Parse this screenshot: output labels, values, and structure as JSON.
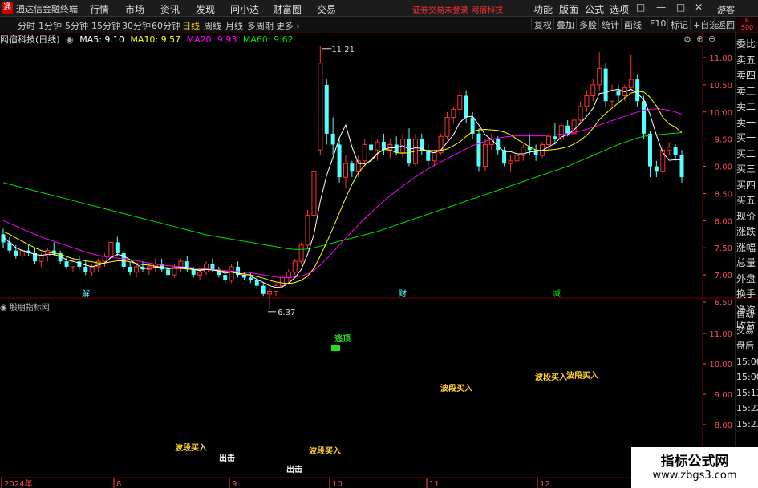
{
  "menubar": {
    "app_title": "通达信金融终端",
    "logo_glyph": "通",
    "items": [
      "行情",
      "市场",
      "资讯",
      "发现",
      "问小达",
      "财富圈",
      "交易"
    ],
    "notice": "证券交易未登录 网宿科技",
    "right_items": [
      "功能",
      "版面",
      "公式",
      "选项"
    ],
    "guest": "游客",
    "window_buttons": [
      "□",
      "—",
      "□",
      "✕"
    ]
  },
  "toolbar": {
    "timeframes": [
      "分时",
      "1分钟",
      "5分钟",
      "15分钟",
      "30分钟",
      "60分钟",
      "日线",
      "周线",
      "月线",
      "多周期",
      "更多 ›"
    ],
    "active": "日线",
    "right_buttons": [
      "复权",
      "叠加",
      "多股",
      "统计",
      "画线",
      "F10",
      "标记",
      "+自选",
      "返回"
    ],
    "corner_top": "R",
    "corner_bottom": "500"
  },
  "info": {
    "stock": "网宿科技(日线)",
    "ma5": "MA5: 9.10",
    "ma10": "MA10: 9.57",
    "ma20": "MA20: 9.93",
    "ma60": "MA60: 9.62"
  },
  "colors": {
    "up": "#ff3232",
    "down": "#54ffff",
    "ma5": "#ffffff",
    "ma10": "#ffff00",
    "ma20": "#ff00ff",
    "ma60": "#00e000",
    "grid": "#7a0000",
    "axis_text": "#ff5050",
    "signal": "#ffd030"
  },
  "price_axis": [
    "11.00",
    "10.50",
    "10.00",
    "9.50",
    "9.00",
    "8.50",
    "8.00",
    "7.50",
    "7.00",
    "6.50"
  ],
  "chart_data": {
    "type": "candlestick",
    "ylim": [
      6.3,
      11.3
    ],
    "annotations": {
      "high": "11.21",
      "low": "6.37"
    },
    "event_labels": [
      "解",
      "财",
      "减"
    ],
    "ohlc": [
      [
        7.75,
        7.85,
        7.5,
        7.6
      ],
      [
        7.6,
        7.7,
        7.4,
        7.45
      ],
      [
        7.45,
        7.55,
        7.3,
        7.35
      ],
      [
        7.35,
        7.5,
        7.25,
        7.45
      ],
      [
        7.45,
        7.55,
        7.35,
        7.4
      ],
      [
        7.4,
        7.5,
        7.2,
        7.25
      ],
      [
        7.25,
        7.4,
        7.15,
        7.35
      ],
      [
        7.35,
        7.5,
        7.25,
        7.45
      ],
      [
        7.45,
        7.6,
        7.35,
        7.4
      ],
      [
        7.4,
        7.45,
        7.2,
        7.25
      ],
      [
        7.25,
        7.35,
        7.1,
        7.15
      ],
      [
        7.15,
        7.3,
        7.05,
        7.25
      ],
      [
        7.25,
        7.35,
        7.1,
        7.15
      ],
      [
        7.15,
        7.25,
        7.0,
        7.05
      ],
      [
        7.05,
        7.2,
        6.98,
        7.15
      ],
      [
        7.15,
        7.3,
        7.05,
        7.25
      ],
      [
        7.25,
        7.4,
        7.15,
        7.35
      ],
      [
        7.35,
        7.7,
        7.3,
        7.6
      ],
      [
        7.6,
        7.7,
        7.35,
        7.4
      ],
      [
        7.4,
        7.45,
        7.1,
        7.15
      ],
      [
        7.15,
        7.25,
        7.0,
        7.05
      ],
      [
        7.05,
        7.2,
        6.95,
        7.15
      ],
      [
        7.15,
        7.25,
        7.05,
        7.1
      ],
      [
        7.1,
        7.2,
        7.0,
        7.15
      ],
      [
        7.15,
        7.3,
        7.05,
        7.2
      ],
      [
        7.2,
        7.3,
        7.05,
        7.1
      ],
      [
        7.1,
        7.15,
        6.95,
        7.0
      ],
      [
        7.0,
        7.2,
        6.95,
        7.15
      ],
      [
        7.15,
        7.3,
        7.05,
        7.25
      ],
      [
        7.25,
        7.35,
        7.05,
        7.1
      ],
      [
        7.1,
        7.15,
        6.95,
        7.0
      ],
      [
        7.0,
        7.1,
        6.9,
        7.05
      ],
      [
        7.05,
        7.25,
        7.0,
        7.2
      ],
      [
        7.2,
        7.3,
        7.05,
        7.1
      ],
      [
        7.1,
        7.15,
        6.95,
        7.0
      ],
      [
        7.0,
        7.05,
        6.85,
        6.9
      ],
      [
        6.9,
        7.2,
        6.85,
        7.15
      ],
      [
        7.15,
        7.25,
        6.95,
        7.0
      ],
      [
        7.0,
        7.05,
        6.9,
        6.95
      ],
      [
        6.95,
        7.05,
        6.85,
        6.9
      ],
      [
        6.9,
        6.95,
        6.75,
        6.8
      ],
      [
        6.8,
        6.85,
        6.6,
        6.65
      ],
      [
        6.65,
        6.75,
        6.37,
        6.7
      ],
      [
        6.7,
        6.85,
        6.6,
        6.8
      ],
      [
        6.8,
        7.0,
        6.75,
        6.95
      ],
      [
        6.95,
        7.1,
        6.85,
        7.05
      ],
      [
        7.05,
        7.3,
        7.0,
        7.25
      ],
      [
        7.25,
        7.6,
        7.2,
        7.55
      ],
      [
        7.55,
        8.2,
        7.5,
        8.1
      ],
      [
        8.1,
        9.0,
        8.0,
        8.9
      ],
      [
        9.3,
        11.21,
        9.2,
        10.9
      ],
      [
        10.5,
        10.6,
        9.4,
        9.6
      ],
      [
        9.6,
        9.9,
        9.2,
        9.4
      ],
      [
        9.4,
        9.5,
        8.7,
        8.8
      ],
      [
        8.8,
        9.2,
        8.6,
        9.05
      ],
      [
        9.05,
        9.1,
        8.8,
        8.9
      ],
      [
        8.9,
        9.2,
        8.8,
        9.1
      ],
      [
        9.1,
        9.5,
        9.0,
        9.4
      ],
      [
        9.4,
        9.6,
        9.2,
        9.3
      ],
      [
        9.3,
        9.5,
        9.1,
        9.45
      ],
      [
        9.45,
        9.6,
        9.2,
        9.3
      ],
      [
        9.3,
        9.5,
        9.15,
        9.4
      ],
      [
        9.4,
        9.55,
        9.2,
        9.25
      ],
      [
        9.25,
        9.6,
        9.15,
        9.5
      ],
      [
        9.5,
        9.7,
        9.0,
        9.05
      ],
      [
        9.05,
        9.6,
        9.0,
        9.5
      ],
      [
        9.5,
        9.6,
        9.2,
        9.3
      ],
      [
        9.3,
        9.4,
        9.0,
        9.1
      ],
      [
        9.1,
        9.3,
        9.0,
        9.25
      ],
      [
        9.25,
        9.6,
        9.2,
        9.55
      ],
      [
        9.55,
        10.0,
        9.5,
        9.9
      ],
      [
        9.9,
        10.1,
        9.8,
        10.05
      ],
      [
        10.05,
        10.5,
        9.95,
        10.3
      ],
      [
        10.3,
        10.4,
        9.8,
        9.9
      ],
      [
        9.9,
        10.0,
        9.5,
        9.6
      ],
      [
        9.6,
        9.7,
        8.9,
        9.0
      ],
      [
        9.0,
        9.5,
        8.9,
        9.4
      ],
      [
        9.4,
        9.6,
        9.3,
        9.5
      ],
      [
        9.5,
        9.55,
        9.2,
        9.3
      ],
      [
        9.3,
        9.35,
        9.0,
        9.05
      ],
      [
        9.05,
        9.2,
        8.9,
        9.1
      ],
      [
        9.1,
        9.3,
        9.0,
        9.2
      ],
      [
        9.2,
        9.4,
        9.1,
        9.35
      ],
      [
        9.35,
        9.6,
        9.2,
        9.3
      ],
      [
        9.3,
        9.4,
        9.1,
        9.2
      ],
      [
        9.2,
        9.45,
        9.15,
        9.4
      ],
      [
        9.4,
        9.6,
        9.3,
        9.55
      ],
      [
        9.55,
        9.8,
        9.4,
        9.5
      ],
      [
        9.5,
        9.8,
        9.45,
        9.75
      ],
      [
        9.75,
        9.85,
        9.55,
        9.6
      ],
      [
        9.6,
        9.9,
        9.55,
        9.85
      ],
      [
        9.85,
        10.2,
        9.8,
        10.1
      ],
      [
        10.1,
        10.4,
        10.0,
        10.3
      ],
      [
        10.3,
        10.6,
        10.2,
        10.5
      ],
      [
        10.5,
        11.1,
        10.4,
        10.8
      ],
      [
        10.8,
        10.9,
        10.1,
        10.2
      ],
      [
        10.2,
        10.5,
        10.1,
        10.4
      ],
      [
        10.4,
        10.5,
        10.2,
        10.3
      ],
      [
        10.3,
        10.5,
        10.2,
        10.45
      ],
      [
        10.45,
        11.05,
        10.4,
        10.6
      ],
      [
        10.6,
        10.7,
        10.1,
        10.2
      ],
      [
        10.2,
        10.3,
        9.5,
        9.6
      ],
      [
        9.6,
        9.65,
        8.8,
        9.0
      ],
      [
        9.0,
        9.1,
        8.8,
        8.9
      ],
      [
        8.9,
        9.4,
        8.85,
        9.3
      ],
      [
        9.3,
        9.45,
        9.2,
        9.35
      ],
      [
        9.35,
        9.4,
        9.1,
        9.2
      ],
      [
        9.2,
        9.3,
        8.7,
        8.8
      ]
    ],
    "ma5": [
      7.7,
      7.6,
      7.5,
      7.45,
      7.42,
      7.38,
      7.36,
      7.38,
      7.38,
      7.34,
      7.28,
      7.25,
      7.22,
      7.18,
      7.15,
      7.18,
      7.22,
      7.32,
      7.38,
      7.35,
      7.28,
      7.2,
      7.12,
      7.12,
      7.14,
      7.14,
      7.11,
      7.13,
      7.14,
      7.14,
      7.1,
      7.08,
      7.1,
      7.09,
      7.07,
      7.03,
      7.06,
      7.03,
      6.99,
      6.98,
      6.92,
      6.86,
      6.8,
      6.77,
      6.78,
      6.85,
      6.95,
      7.1,
      7.38,
      7.75,
      8.36,
      8.83,
      9.16,
      9.52,
      9.76,
      9.35,
      9.05,
      9.05,
      9.1,
      9.23,
      9.31,
      9.34,
      9.34,
      9.38,
      9.31,
      9.34,
      9.33,
      9.27,
      9.25,
      9.3,
      9.44,
      9.58,
      9.81,
      9.91,
      9.92,
      9.76,
      9.58,
      9.49,
      9.37,
      9.27,
      9.27,
      9.23,
      9.23,
      9.26,
      9.28,
      9.29,
      9.36,
      9.42,
      9.54,
      9.58,
      9.67,
      9.79,
      9.92,
      10.07,
      10.34,
      10.36,
      10.4,
      10.42,
      10.37,
      10.42,
      10.34,
      10.23,
      9.95,
      9.57,
      9.25,
      9.11,
      9.12,
      9.12
    ],
    "ma10": [
      7.8,
      7.75,
      7.68,
      7.62,
      7.56,
      7.5,
      7.45,
      7.42,
      7.4,
      7.38,
      7.34,
      7.3,
      7.28,
      7.26,
      7.24,
      7.22,
      7.22,
      7.24,
      7.26,
      7.26,
      7.24,
      7.21,
      7.19,
      7.18,
      7.16,
      7.14,
      7.13,
      7.12,
      7.12,
      7.11,
      7.1,
      7.1,
      7.1,
      7.09,
      7.08,
      7.06,
      7.05,
      7.03,
      7.02,
      7.0,
      6.97,
      6.94,
      6.9,
      6.87,
      6.85,
      6.84,
      6.86,
      6.9,
      6.98,
      7.12,
      7.35,
      7.6,
      7.86,
      8.14,
      8.42,
      8.67,
      8.88,
      9.02,
      9.12,
      9.24,
      9.31,
      9.3,
      9.25,
      9.24,
      9.25,
      9.28,
      9.3,
      9.29,
      9.29,
      9.29,
      9.32,
      9.38,
      9.45,
      9.55,
      9.64,
      9.67,
      9.68,
      9.67,
      9.66,
      9.63,
      9.58,
      9.5,
      9.43,
      9.36,
      9.3,
      9.29,
      9.3,
      9.31,
      9.33,
      9.36,
      9.41,
      9.48,
      9.57,
      9.7,
      9.86,
      9.97,
      10.07,
      10.17,
      10.26,
      10.35,
      10.38,
      10.37,
      10.27,
      10.11,
      9.9,
      9.78,
      9.72,
      9.62
    ],
    "ma20": [
      8.0,
      7.95,
      7.9,
      7.85,
      7.8,
      7.75,
      7.7,
      7.66,
      7.62,
      7.58,
      7.54,
      7.5,
      7.46,
      7.42,
      7.39,
      7.36,
      7.34,
      7.32,
      7.31,
      7.3,
      7.28,
      7.26,
      7.24,
      7.22,
      7.2,
      7.18,
      7.17,
      7.16,
      7.15,
      7.14,
      7.13,
      7.12,
      7.11,
      7.1,
      7.09,
      7.08,
      7.07,
      7.06,
      7.05,
      7.04,
      7.02,
      7.0,
      6.98,
      6.96,
      6.95,
      6.95,
      6.96,
      6.98,
      7.02,
      7.08,
      7.18,
      7.3,
      7.42,
      7.55,
      7.68,
      7.8,
      7.92,
      8.04,
      8.15,
      8.26,
      8.36,
      8.46,
      8.55,
      8.64,
      8.72,
      8.8,
      8.88,
      8.95,
      9.02,
      9.08,
      9.14,
      9.2,
      9.26,
      9.32,
      9.38,
      9.42,
      9.46,
      9.5,
      9.52,
      9.54,
      9.55,
      9.56,
      9.56,
      9.56,
      9.56,
      9.56,
      9.57,
      9.58,
      9.59,
      9.6,
      9.62,
      9.65,
      9.68,
      9.72,
      9.76,
      9.8,
      9.84,
      9.88,
      9.92,
      9.96,
      10.0,
      10.03,
      10.05,
      10.06,
      10.05,
      10.03,
      10.0,
      9.96
    ],
    "ma60": [
      8.7,
      8.67,
      8.64,
      8.61,
      8.58,
      8.55,
      8.52,
      8.49,
      8.46,
      8.43,
      8.4,
      8.37,
      8.34,
      8.31,
      8.28,
      8.25,
      8.22,
      8.19,
      8.16,
      8.13,
      8.1,
      8.07,
      8.04,
      8.01,
      7.98,
      7.95,
      7.92,
      7.89,
      7.86,
      7.83,
      7.8,
      7.77,
      7.74,
      7.72,
      7.7,
      7.68,
      7.66,
      7.64,
      7.62,
      7.6,
      7.58,
      7.56,
      7.54,
      7.52,
      7.5,
      7.48,
      7.47,
      7.47,
      7.48,
      7.5,
      7.53,
      7.56,
      7.59,
      7.62,
      7.65,
      7.68,
      7.71,
      7.74,
      7.77,
      7.8,
      7.84,
      7.88,
      7.92,
      7.96,
      8.0,
      8.04,
      8.08,
      8.12,
      8.16,
      8.2,
      8.24,
      8.28,
      8.32,
      8.36,
      8.4,
      8.44,
      8.48,
      8.52,
      8.56,
      8.6,
      8.64,
      8.68,
      8.72,
      8.76,
      8.8,
      8.84,
      8.88,
      8.92,
      8.96,
      9.0,
      9.05,
      9.1,
      9.15,
      9.2,
      9.25,
      9.3,
      9.35,
      9.4,
      9.44,
      9.48,
      9.52,
      9.55,
      9.57,
      9.58,
      9.59,
      9.6,
      9.61,
      9.62
    ]
  },
  "indicator": {
    "title": "股朋指标网",
    "axis": [
      "11.00",
      "10.00",
      "9.00",
      "8.00"
    ],
    "labels": [
      {
        "text": "逃顶",
        "color": "#20e020"
      },
      {
        "text": "波段买入",
        "color": "#ffd030"
      },
      {
        "text": "波段买入",
        "color": "#ffd030"
      },
      {
        "text": "波段买入",
        "color": "#ffd030"
      },
      {
        "text": "出击",
        "color": "#ffffff"
      },
      {
        "text": "波段买入",
        "color": "#ffd030"
      },
      {
        "text": "出击",
        "color": "#ffffff"
      },
      {
        "text": "波段买入",
        "color": "#ffd030"
      }
    ]
  },
  "time_axis": [
    "2024年",
    "8",
    "9",
    "10",
    "11",
    "12"
  ],
  "right_panel": [
    "委比",
    "卖五",
    "卖四",
    "卖三",
    "卖二",
    "卖一",
    "买一",
    "买二",
    "买三",
    "买四",
    "买五",
    "现价",
    "涨跌",
    "涨幅",
    "总量",
    "外盘",
    "换手",
    "净资",
    "收益"
  ],
  "bottom_panel": [
    "自动",
    "交易",
    "盘后",
    "15:00",
    "15:00",
    "15:13",
    "15:22",
    "15:23"
  ],
  "watermark": {
    "line1": "指标公式网",
    "line2": "www.zbgs3.com"
  }
}
